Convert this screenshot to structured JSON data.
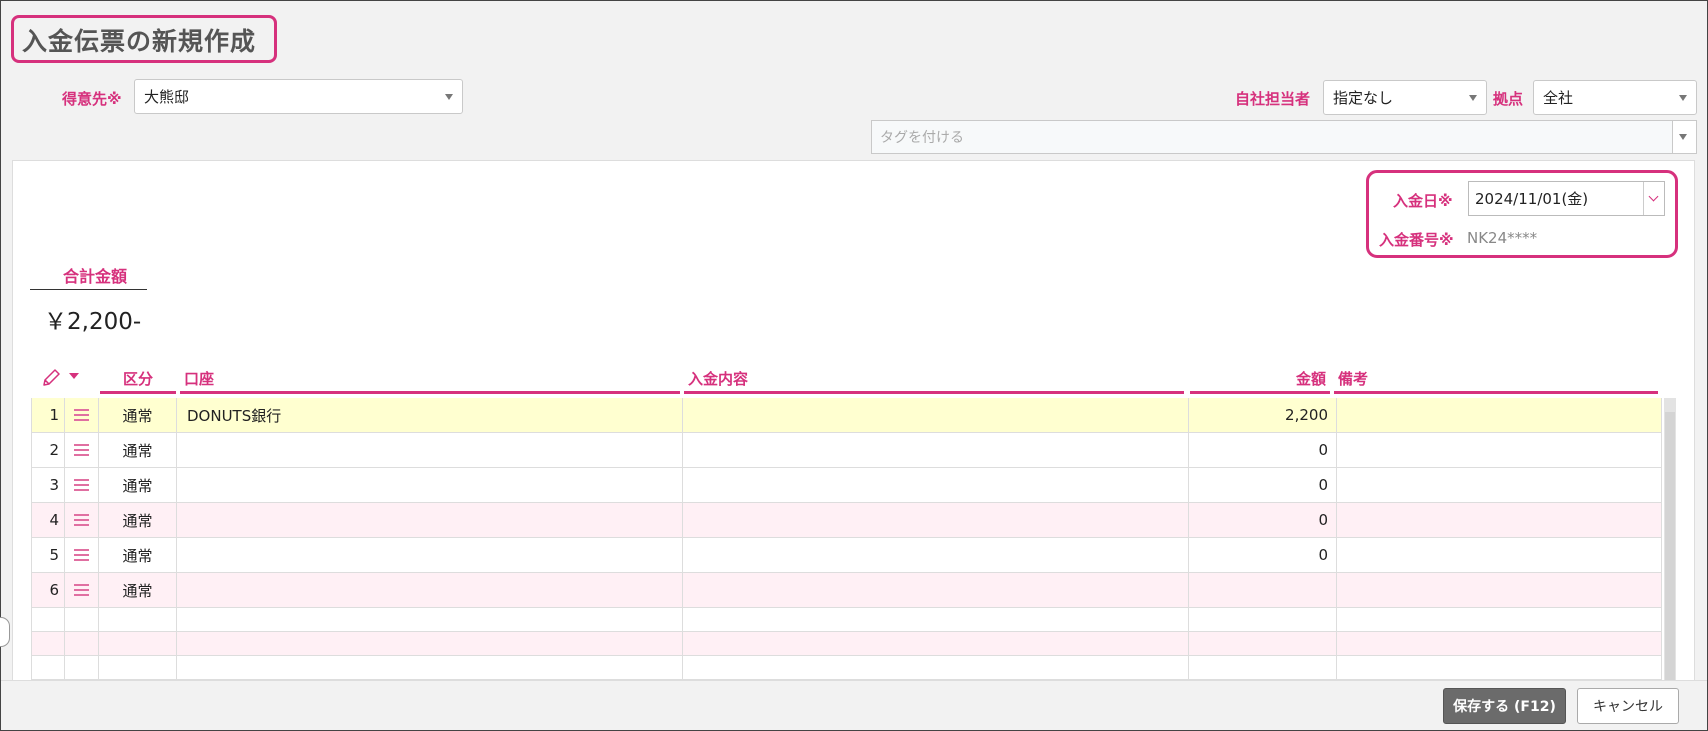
{
  "page": {
    "title": "入金伝票の新規作成"
  },
  "header": {
    "customer_label": "得意先",
    "required_mark": "※",
    "customer_value": "大熊邸",
    "staff_label": "自社担当者",
    "staff_value": "指定なし",
    "base_label": "拠点",
    "base_value": "全社",
    "tag_placeholder": "タグを付ける"
  },
  "meta": {
    "date_label": "入金日",
    "date_value": "2024/11/01(金)",
    "number_label": "入金番号",
    "number_value": "NK24****"
  },
  "summary": {
    "total_label": "合計金額",
    "total_value": "￥2,200-"
  },
  "table": {
    "headers": {
      "kubun": "区分",
      "koza": "口座",
      "naiyo": "入金内容",
      "kingaku": "金額",
      "biko": "備考"
    },
    "rows": [
      {
        "no": "1",
        "kubun": "通常",
        "koza": "DONUTS銀行",
        "naiyo": "",
        "kingaku": "2,200",
        "biko": ""
      },
      {
        "no": "2",
        "kubun": "通常",
        "koza": "",
        "naiyo": "",
        "kingaku": "0",
        "biko": ""
      },
      {
        "no": "3",
        "kubun": "通常",
        "koza": "",
        "naiyo": "",
        "kingaku": "0",
        "biko": ""
      },
      {
        "no": "4",
        "kubun": "通常",
        "koza": "",
        "naiyo": "",
        "kingaku": "0",
        "biko": ""
      },
      {
        "no": "5",
        "kubun": "通常",
        "koza": "",
        "naiyo": "",
        "kingaku": "0",
        "biko": ""
      },
      {
        "no": "6",
        "kubun": "通常",
        "koza": "",
        "naiyo": "",
        "kingaku": "",
        "biko": ""
      }
    ]
  },
  "footer": {
    "save_label": "保存する (F12)",
    "cancel_label": "キャンセル"
  },
  "colors": {
    "accent": "#d6317d",
    "row_yellow": "#ffffd0",
    "row_pink": "#fff0f5",
    "save_bg": "#6b6b6b"
  }
}
